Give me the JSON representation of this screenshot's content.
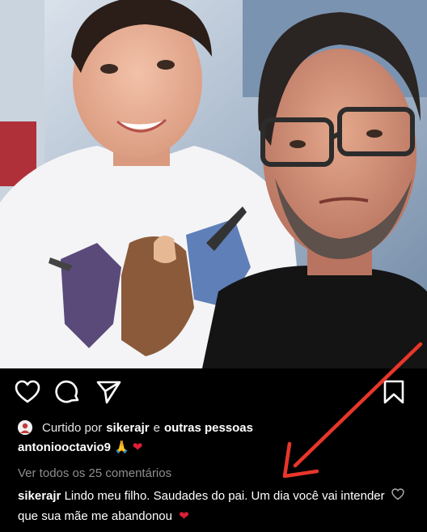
{
  "post": {
    "liked_by_prefix": "Curtido por",
    "liked_by_user": "sikerajr",
    "liked_by_conjunction": "e",
    "liked_by_others": "outras pessoas",
    "caption_user": "antoniooctavio9",
    "caption_emoji_pray": "🙏",
    "caption_emoji_heart": "❤",
    "view_comments": "Ver todos os 25 comentários",
    "comment": {
      "user": "sikerajr",
      "text": "Lindo meu filho. Saudades do pai. Um dia você vai intender que sua mãe me abandonou",
      "emoji": "❤"
    }
  },
  "icons": {
    "like": "heart-icon",
    "comment": "comment-icon",
    "share": "paper-plane-icon",
    "save": "bookmark-icon",
    "comment_like": "heart-outline-icon"
  },
  "colors": {
    "background": "#000000",
    "muted_text": "#8e8e8e",
    "heart": "#e01e37",
    "annotation_arrow": "#e8362a"
  }
}
